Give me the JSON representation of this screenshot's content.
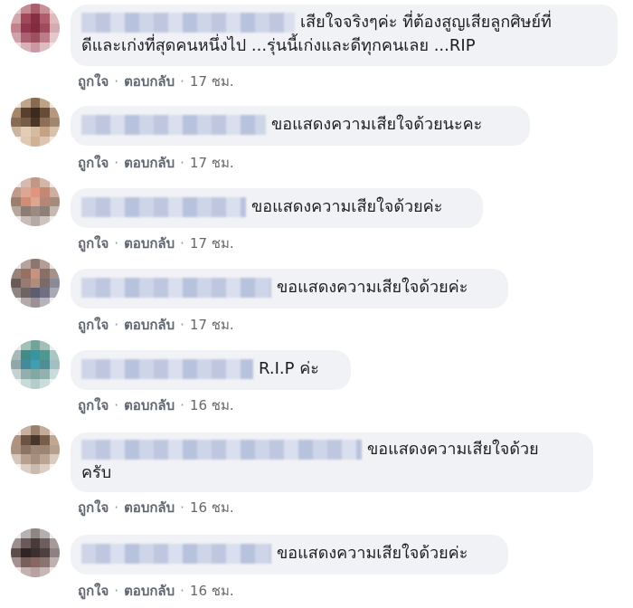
{
  "comments": [
    {
      "text_line1": "เสียใจจริงๆค่ะ ที่ต้องสูญเสียลูกศิษย์ที่",
      "text_line2": "ดีและเก่งที่สุดคนหนึ่งไป ...รุ่นนี้เก่งและดีทุกคนเลย ...RIP",
      "like": "ถูกใจ",
      "reply": "ตอบกลับ",
      "time": "17 ชม.",
      "avatar_colors": [
        "#e7c6c8",
        "#c98a93",
        "#b35b6b",
        "#cf8d96",
        "#ecd6d8",
        "#d7a7ad",
        "#a9465a",
        "#8f2c44",
        "#b65a6c",
        "#e0b9be",
        "#c8808c",
        "#9a3550",
        "#8a2a41",
        "#a84a5c",
        "#d9a9b1",
        "#d6a0a9",
        "#b06070",
        "#a34e60",
        "#c07c88",
        "#e6c8cc",
        "#eed9dc",
        "#dbb1b8",
        "#cf97a1",
        "#e1bcc2",
        "#f2e3e5"
      ]
    },
    {
      "text_line1": "ขอแสดงความเสียใจด้วยนะคะ",
      "like": "ถูกใจ",
      "reply": "ตอบกลับ",
      "time": "17 ชม.",
      "avatar_colors": [
        "#efe3d6",
        "#c3a488",
        "#8a6a4e",
        "#c2a386",
        "#f0e4d8",
        "#a98565",
        "#5b3f2a",
        "#3f2a1c",
        "#6a4c35",
        "#b8987a",
        "#8a6a52",
        "#7a5c44",
        "#4d3626",
        "#8e6e55",
        "#a5866a",
        "#cfb49b",
        "#e6cdb3",
        "#d9bb9d",
        "#c6a27f",
        "#d9c2aa",
        "#f5ece3",
        "#e2c9ae",
        "#d3b08f",
        "#e0c5aa",
        "#f3e8dc"
      ]
    },
    {
      "text_line1": "ขอแสดงความเสียใจด้วยค่ะ",
      "like": "ถูกใจ",
      "reply": "ตอบกลับ",
      "time": "17 ชม.",
      "avatar_colors": [
        "#f1e6e0",
        "#d9b9ac",
        "#c79684",
        "#d7b4a6",
        "#f2e8e2",
        "#c39a88",
        "#e2a490",
        "#e6937b",
        "#c98670",
        "#cfae9f",
        "#9f7d6c",
        "#d88a72",
        "#e3a58e",
        "#b88673",
        "#a98a7b",
        "#b8a69c",
        "#8e7c73",
        "#9b8a80",
        "#8f7f77",
        "#c5b8b1",
        "#efe8e5",
        "#c9bdb6",
        "#b7aaa3",
        "#cfc4be",
        "#f3eeeb"
      ]
    },
    {
      "text_line1": "ขอแสดงความเสียใจด้วยค่ะ",
      "like": "ถูกใจ",
      "reply": "ตอบกลับ",
      "time": "17 ชม.",
      "avatar_colors": [
        "#ece3df",
        "#b8a39c",
        "#8f766f",
        "#b49d96",
        "#ede5e2",
        "#9c8078",
        "#9b6f60",
        "#c9927c",
        "#8b6e66",
        "#a8928b",
        "#6b5b59",
        "#9a7a70",
        "#b78a79",
        "#7d6a66",
        "#8a8b9a",
        "#8f8583",
        "#6f6463",
        "#5c5d70",
        "#6f7185",
        "#a9a8b4",
        "#e9e4e3",
        "#b3abaa",
        "#9b9296",
        "#b7b3bb",
        "#efecef"
      ]
    },
    {
      "text_line1": "R.I.P ค่ะ",
      "like": "ถูกใจ",
      "reply": "ตอบกลับ",
      "time": "16 ชม.",
      "avatar_colors": [
        "#e1ece9",
        "#9fc2bb",
        "#6fa59c",
        "#9ec0b9",
        "#e3eeeb",
        "#a3b9b6",
        "#3c8e88",
        "#2f97a3",
        "#4a9a90",
        "#a9c7c1",
        "#8fa6a8",
        "#3f8aa0",
        "#36a1b5",
        "#4b8f99",
        "#a0c0c2",
        "#c3d3d1",
        "#8fb0ad",
        "#7fa9a6",
        "#90b2ae",
        "#c9dcd9",
        "#eef4f3",
        "#c8dbd8",
        "#b3cdca",
        "#cadcda",
        "#f1f6f5"
      ]
    },
    {
      "text_line1": "ขอแสดงความเสียใจด้วย",
      "text_line2": "ครับ",
      "like": "ถูกใจ",
      "reply": "ตอบกลับ",
      "time": "16 ชม.",
      "avatar_colors": [
        "#f1e9e3",
        "#c9b09d",
        "#9c7f6a",
        "#c5ac98",
        "#f2eae4",
        "#b2937c",
        "#6e5241",
        "#4a362a",
        "#7b5d49",
        "#c2a690",
        "#ad927f",
        "#8e7462",
        "#a08672",
        "#9d8472",
        "#b99f8b",
        "#d9c6b8",
        "#b8a08e",
        "#a88f7c",
        "#bca592",
        "#dccbbd",
        "#f6f0ec",
        "#ddcfc4",
        "#cdbbad",
        "#dccec3",
        "#f6f1ed"
      ]
    },
    {
      "text_line1": "ขอแสดงความเสียใจด้วยค่ะ",
      "like": "ถูกใจ",
      "reply": "ตอบกลับ",
      "time": "16 ชม.",
      "avatar_colors": [
        "#eceaea",
        "#b9b2b1",
        "#908584",
        "#b5aeac",
        "#eeecec",
        "#9b8f8d",
        "#6a5a58",
        "#4a3b3a",
        "#6e5e5c",
        "#a59a98",
        "#5d4d4b",
        "#2f2524",
        "#3d302f",
        "#4e403f",
        "#8e8281",
        "#a49290",
        "#7a5e5a",
        "#8a6662",
        "#8c7370",
        "#bfb2b0",
        "#ece6e5",
        "#c3b3b0",
        "#b9a29e",
        "#c8b8b5",
        "#f0ebea"
      ]
    }
  ]
}
